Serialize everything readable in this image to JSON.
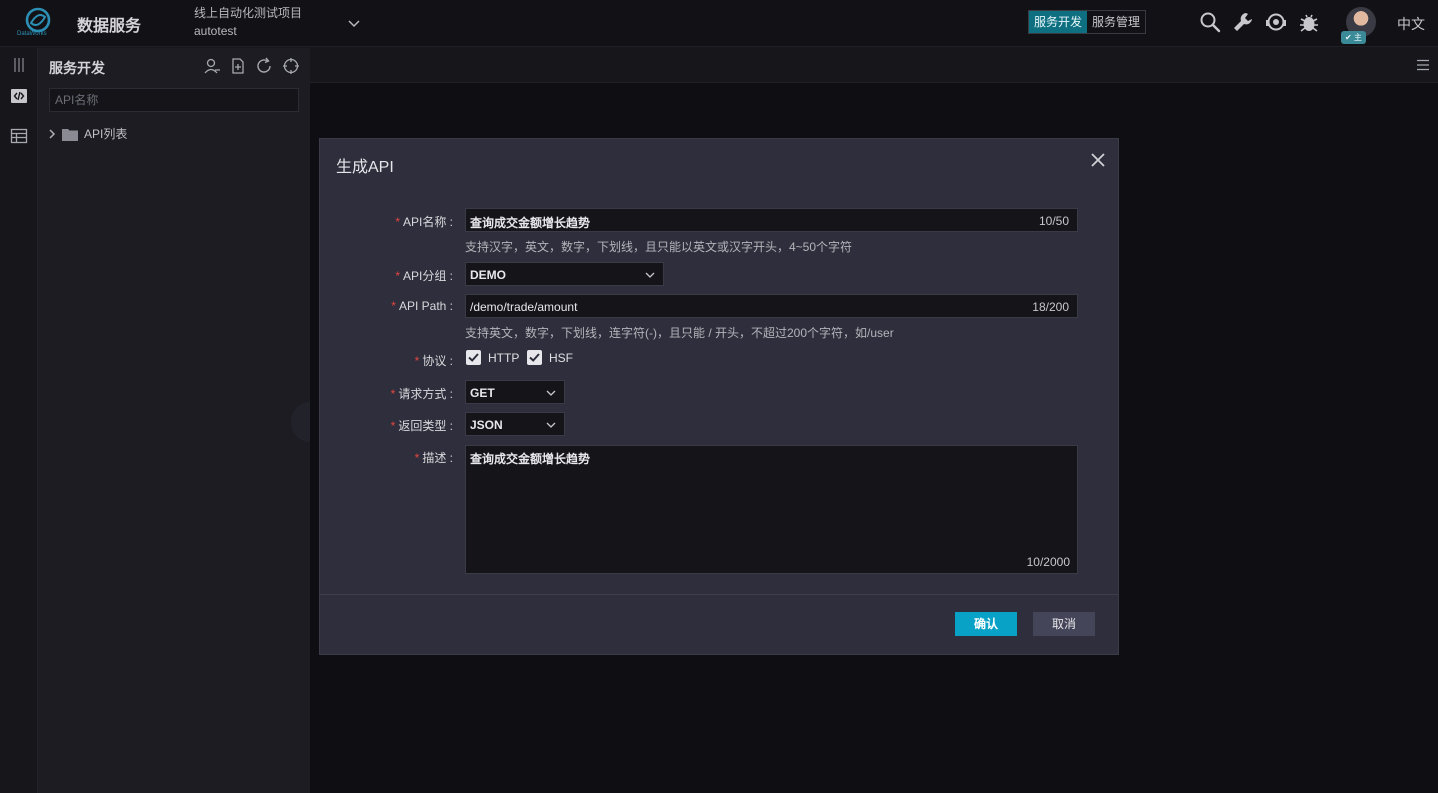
{
  "header": {
    "logo_text": "DataWorks",
    "app_title": "数据服务",
    "project_name": "线上自动化测试项目",
    "project_id": "autotest",
    "modes": [
      "服务开发",
      "服务管理"
    ],
    "owner_badge": "✔ 主",
    "language": "中文"
  },
  "sidebar": {
    "title": "服务开发",
    "search_placeholder": "API名称",
    "tree": [
      {
        "label": "API列表"
      }
    ]
  },
  "dialog": {
    "title": "生成API",
    "fields": {
      "api_name": {
        "label": "API名称 :",
        "value": "查询成交金额增长趋势",
        "count": "10/50",
        "help": "支持汉字，英文，数字，下划线，且只能以英文或汉字开头，4~50个字符"
      },
      "api_group": {
        "label": "API分组 :",
        "value": "DEMO"
      },
      "api_path": {
        "label": "API Path :",
        "value": "/demo/trade/amount",
        "count": "18/200",
        "help": "支持英文，数字，下划线，连字符(-)，且只能 / 开头，不超过200个字符，如/user"
      },
      "protocol": {
        "label": "协议 :",
        "options": [
          "HTTP",
          "HSF"
        ]
      },
      "method": {
        "label": "请求方式 :",
        "value": "GET"
      },
      "return_type": {
        "label": "返回类型 :",
        "value": "JSON"
      },
      "description": {
        "label": "描述 :",
        "value": "查询成交金额增长趋势",
        "count": "10/2000"
      }
    },
    "confirm_label": "确认",
    "cancel_label": "取消"
  },
  "colors": {
    "accent": "#08a2c7",
    "required": "#e2473f",
    "active_mode": "#0d6f80"
  }
}
